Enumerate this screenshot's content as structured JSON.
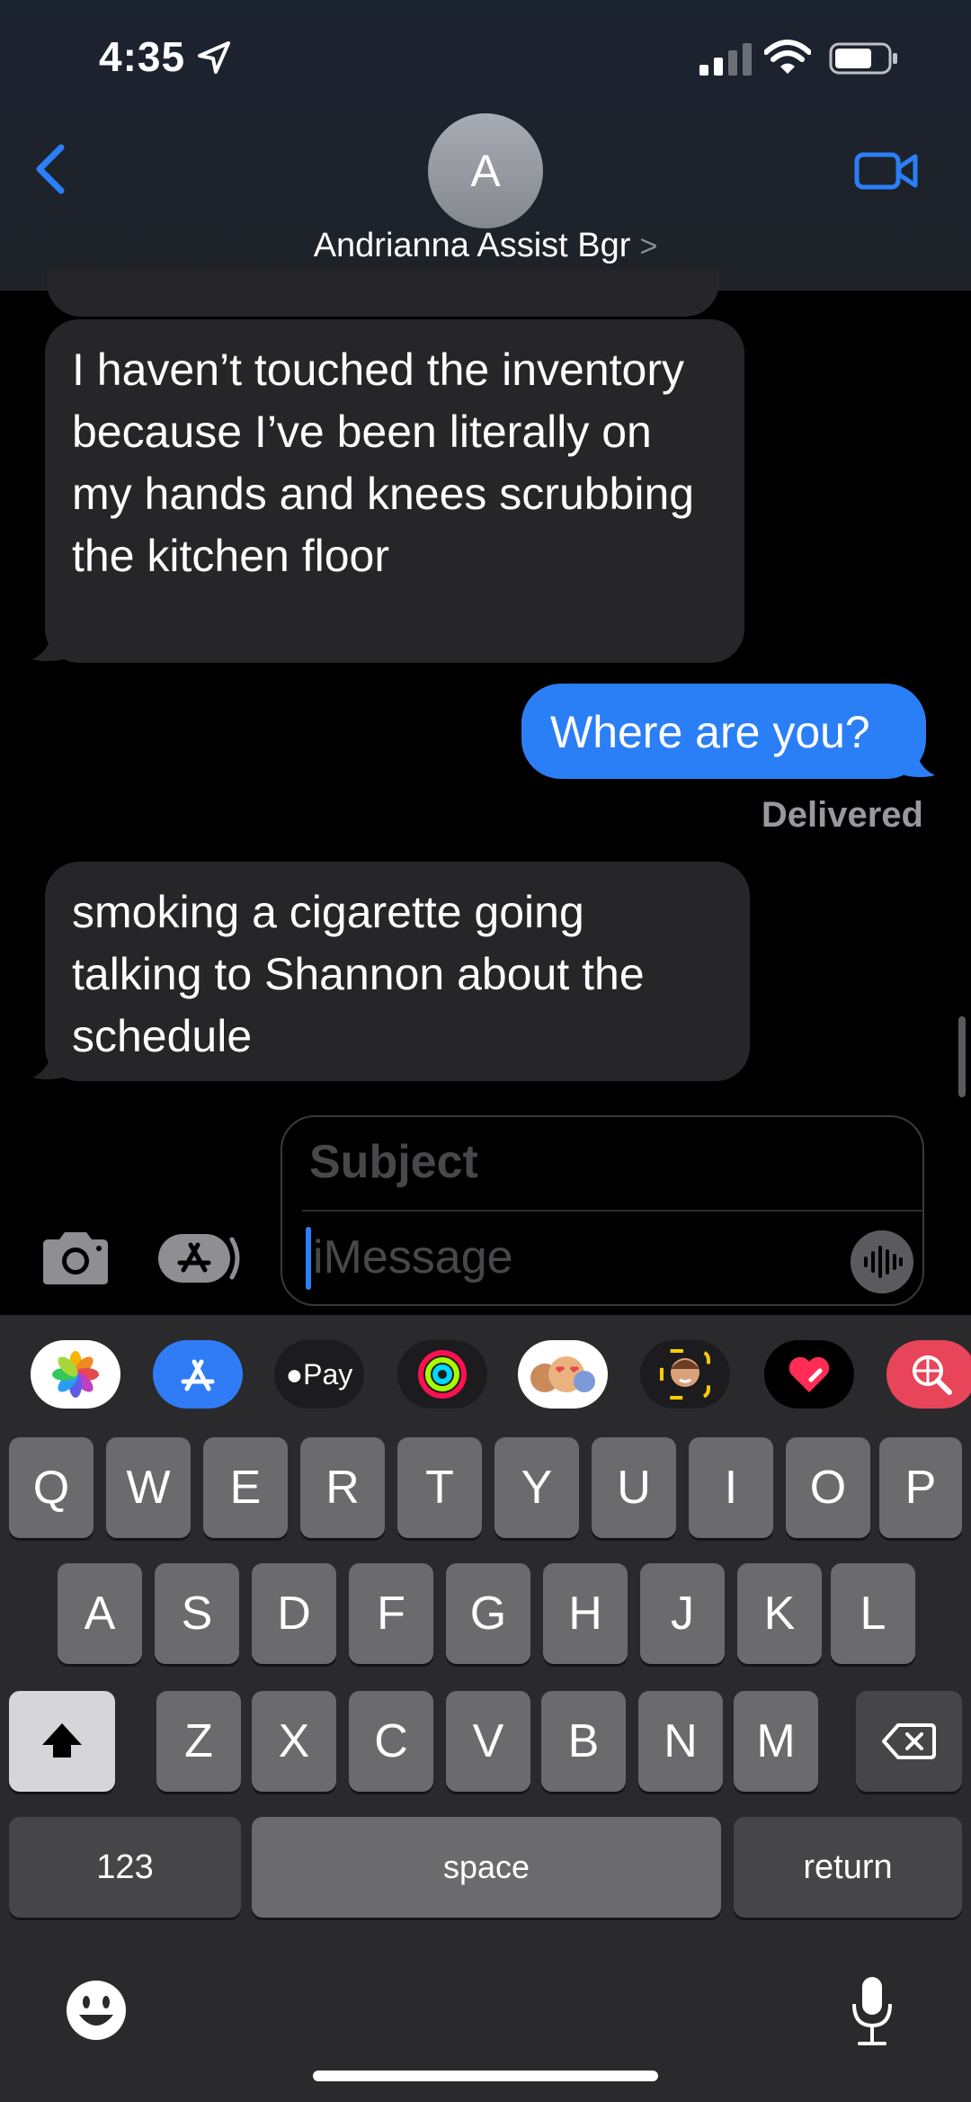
{
  "status_bar": {
    "time": "4:35"
  },
  "header": {
    "avatar_initial": "A",
    "contact_name": "Andrianna Assist Bgr",
    "contact_chevron": ">"
  },
  "messages": [
    {
      "direction": "incoming",
      "text": "I haven’t touched the inventory because I’ve been literally on my hands and knees scrubbing the kitchen floor"
    },
    {
      "direction": "outgoing",
      "text": "Where are you?",
      "status": "Delivered"
    },
    {
      "direction": "incoming",
      "text": "smoking a cigarette going talking to Shannon about the schedule"
    }
  ],
  "compose": {
    "subject_placeholder": "Subject",
    "message_placeholder": "iMessage"
  },
  "app_strip": [
    {
      "name": "photos-app-icon",
      "color": "#ffffff"
    },
    {
      "name": "app-store-app-icon",
      "color": "#2f7cf6"
    },
    {
      "name": "apple-pay-app-icon",
      "label": "Pay",
      "color": "#1c1c1e"
    },
    {
      "name": "activity-app-icon",
      "color": "#1c1c1e"
    },
    {
      "name": "memoji-stickers-app-icon",
      "color": "#ffffff"
    },
    {
      "name": "memoji-app-icon",
      "color": "#1c1c1e"
    },
    {
      "name": "digital-touch-app-icon",
      "color": "#000000"
    },
    {
      "name": "web-search-app-icon",
      "color": "#e8445a"
    }
  ],
  "keyboard": {
    "row1": [
      "Q",
      "W",
      "E",
      "R",
      "T",
      "Y",
      "U",
      "I",
      "O",
      "P"
    ],
    "row2": [
      "A",
      "S",
      "D",
      "F",
      "G",
      "H",
      "J",
      "K",
      "L"
    ],
    "row3": [
      "Z",
      "X",
      "C",
      "V",
      "B",
      "N",
      "M"
    ],
    "numbers_label": "123",
    "space_label": "space",
    "return_label": "return"
  },
  "colors": {
    "accent_blue": "#2b7ff6",
    "incoming_bubble": "#262628",
    "keyboard_bg": "#2a2a2c",
    "key": "#6b6b6e"
  }
}
